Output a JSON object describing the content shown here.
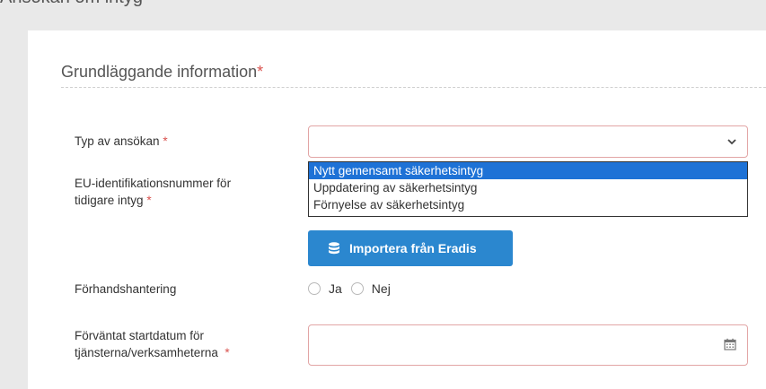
{
  "header": {
    "title": "Ansökan om intyg"
  },
  "section": {
    "title": "Grundläggande information",
    "required_mark": "*"
  },
  "fields": {
    "typ_label": "Typ av ansökan",
    "eu_label_line1": "EU-identifikationsnummer för",
    "eu_label_line2": "tidigare intyg",
    "forhand_label": "Förhandshantering",
    "start_label_line1": "Förväntat startdatum för",
    "start_label_line2": "tjänsterna/verksamheterna",
    "required_mark": "*"
  },
  "dropdown": {
    "options": [
      "Nytt gemensamt säkerhetsintyg",
      "Uppdatering av säkerhetsintyg",
      "Förnyelse av säkerhetsintyg"
    ],
    "highlighted_index": 0
  },
  "import_button": {
    "label": "Importera från Eradis",
    "icon": "database-icon"
  },
  "radio": {
    "yes": "Ja",
    "no": "Nej"
  },
  "colors": {
    "accent": "#2b87cf",
    "highlight": "#1e72d6",
    "required": "#d9534f",
    "invalid_border": "#e2a5a5"
  }
}
